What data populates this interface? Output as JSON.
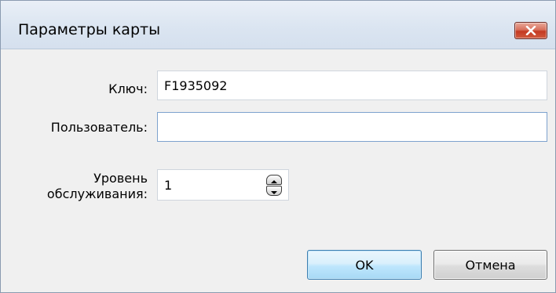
{
  "window": {
    "title": "Параметры карты",
    "close_icon": "close-icon"
  },
  "form": {
    "key_label": "Ключ:",
    "key_value": "F1935092",
    "user_label": "Пользователь:",
    "user_value": "",
    "level_label": "Уровень обслуживания:",
    "level_value": "1",
    "spinner_icons": [
      "chevron-up-icon",
      "chevron-down-icon"
    ]
  },
  "buttons": {
    "ok_label": "OK",
    "cancel_label": "Отмена"
  },
  "colors": {
    "dialog_bg": "#f0f0f0",
    "titlebar_bg": "#dbe5f1",
    "close_button": "#c43a22",
    "focus_border": "#7da2ce",
    "ok_button": "#bee6fd"
  }
}
